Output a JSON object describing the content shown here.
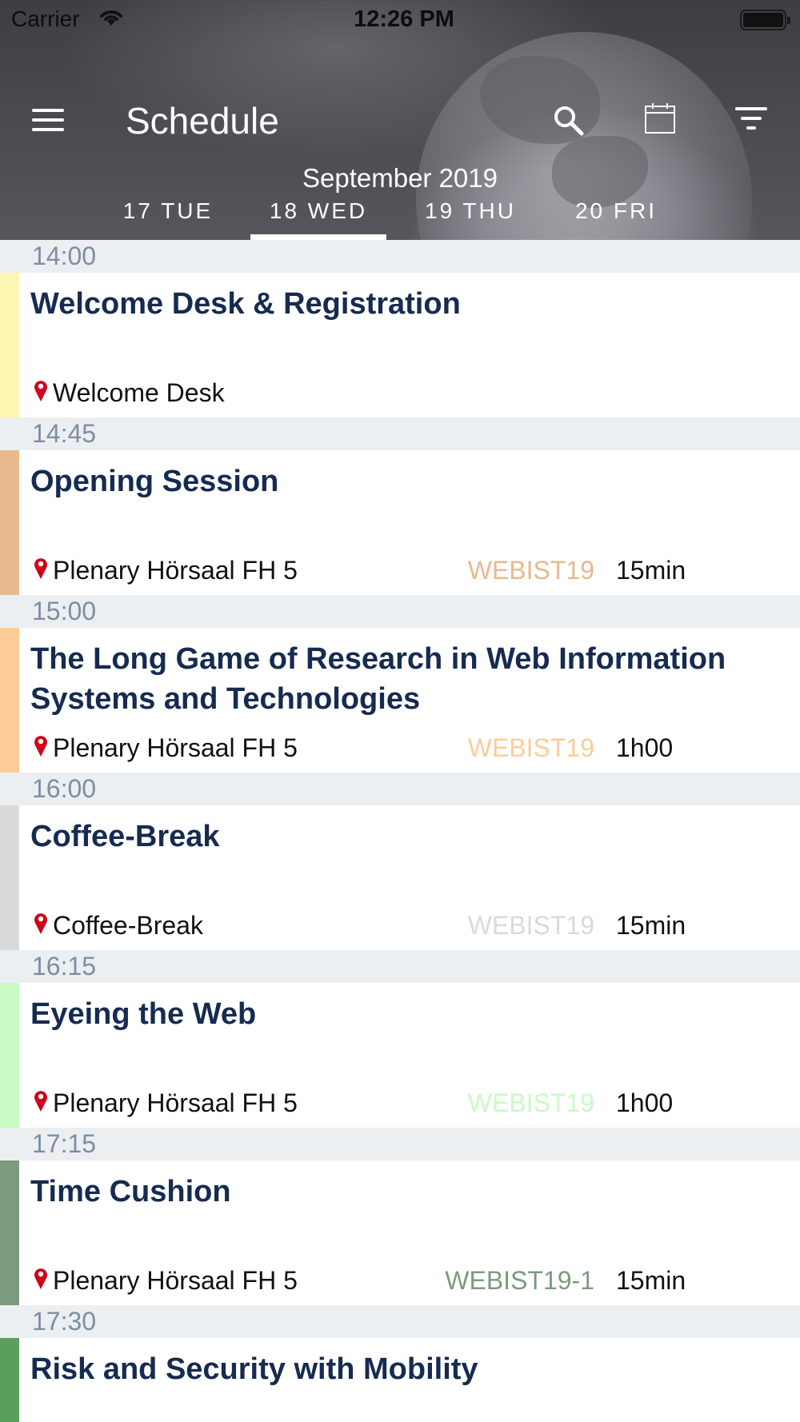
{
  "status_bar": {
    "carrier": "Carrier",
    "time": "12:26 PM"
  },
  "header": {
    "title": "Schedule",
    "month": "September 2019",
    "days": [
      {
        "label": "17 TUE",
        "active": false
      },
      {
        "label": "18 WED",
        "active": true
      },
      {
        "label": "19 THU",
        "active": false
      },
      {
        "label": "20 FRI",
        "active": false
      }
    ],
    "icons": [
      "menu-icon",
      "search-icon",
      "calendar-icon",
      "filter-icon"
    ]
  },
  "schedule": [
    {
      "time": "14:00",
      "title": "Welcome Desk & Registration",
      "location": "Welcome Desk",
      "code": "",
      "duration": "",
      "color": "#fcf6b3"
    },
    {
      "time": "14:45",
      "title": "Opening Session",
      "location": "Plenary Hörsaal FH 5",
      "code": "WEBIST19",
      "duration": "15min",
      "color": "#e8b98d"
    },
    {
      "time": "15:00",
      "title": "The Long Game of Research in Web Information Systems and Technologies",
      "location": "Plenary Hörsaal FH 5",
      "code": "WEBIST19",
      "duration": "1h00",
      "color": "#fdcc99"
    },
    {
      "time": "16:00",
      "title": "Coffee-Break",
      "location": "Coffee-Break",
      "code": "WEBIST19",
      "duration": "15min",
      "color": "#dadada"
    },
    {
      "time": "16:15",
      "title": "Eyeing the Web",
      "location": "Plenary Hörsaal FH 5",
      "code": "WEBIST19",
      "duration": "1h00",
      "color": "#c9fbc4"
    },
    {
      "time": "17:15",
      "title": "Time Cushion",
      "location": "Plenary Hörsaal FH 5",
      "code": "WEBIST19-1",
      "duration": "15min",
      "color": "#7b9b7c"
    },
    {
      "time": "17:30",
      "title": "Risk and Security with Mobility",
      "location": "",
      "code": "",
      "duration": "",
      "color": "#58a05c"
    }
  ],
  "colors": {
    "title_text": "#162b50",
    "time_text": "#7e8ea0",
    "time_row_bg": "#eceff2",
    "pin": "#d0021b"
  }
}
